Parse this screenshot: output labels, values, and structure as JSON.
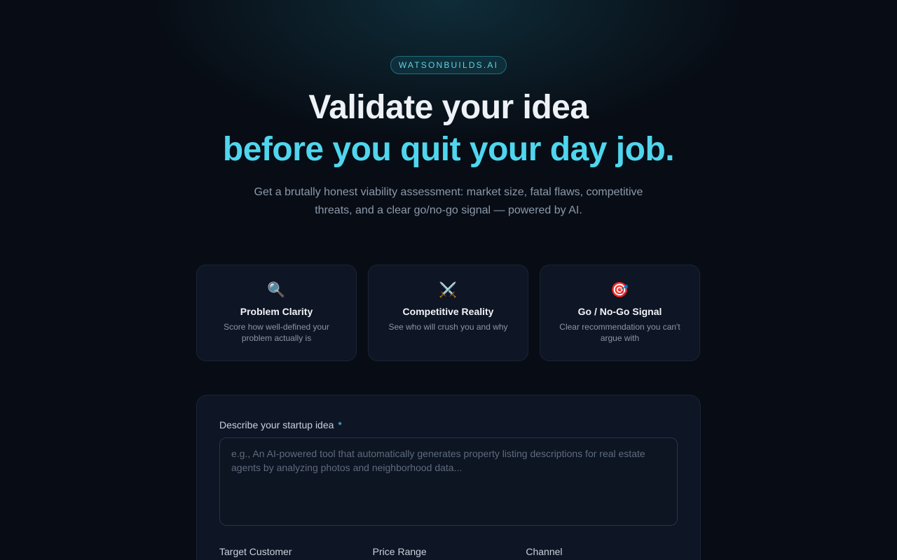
{
  "brand": {
    "label": "WATSONBUILDS.AI"
  },
  "hero": {
    "title_line1": "Validate your idea",
    "title_line2": "before you quit your day job.",
    "subtitle": "Get a brutally honest viability assessment: market size, fatal flaws, competitive threats, and a clear go/no-go signal — powered by AI."
  },
  "features": [
    {
      "icon": "magnifying-glass-icon",
      "glyph": "🔍",
      "title": "Problem Clarity",
      "description": "Score how well-defined your problem actually is"
    },
    {
      "icon": "crossed-swords-icon",
      "glyph": "⚔️",
      "title": "Competitive Reality",
      "description": "See who will crush you and why"
    },
    {
      "icon": "target-icon",
      "glyph": "🎯",
      "title": "Go / No-Go Signal",
      "description": "Clear recommendation you can't argue with"
    }
  ],
  "form": {
    "idea_label": "Describe your startup idea",
    "required_marker": "*",
    "idea_placeholder": "e.g., An AI-powered tool that automatically generates property listing descriptions for real estate agents by analyzing photos and neighborhood data...",
    "idea_value": "",
    "target_customer_label": "Target Customer",
    "price_range_label": "Price Range",
    "channel_label": "Channel"
  },
  "colors": {
    "background": "#080d15",
    "accent": "#4fd6ee",
    "card": "#0e1524"
  }
}
